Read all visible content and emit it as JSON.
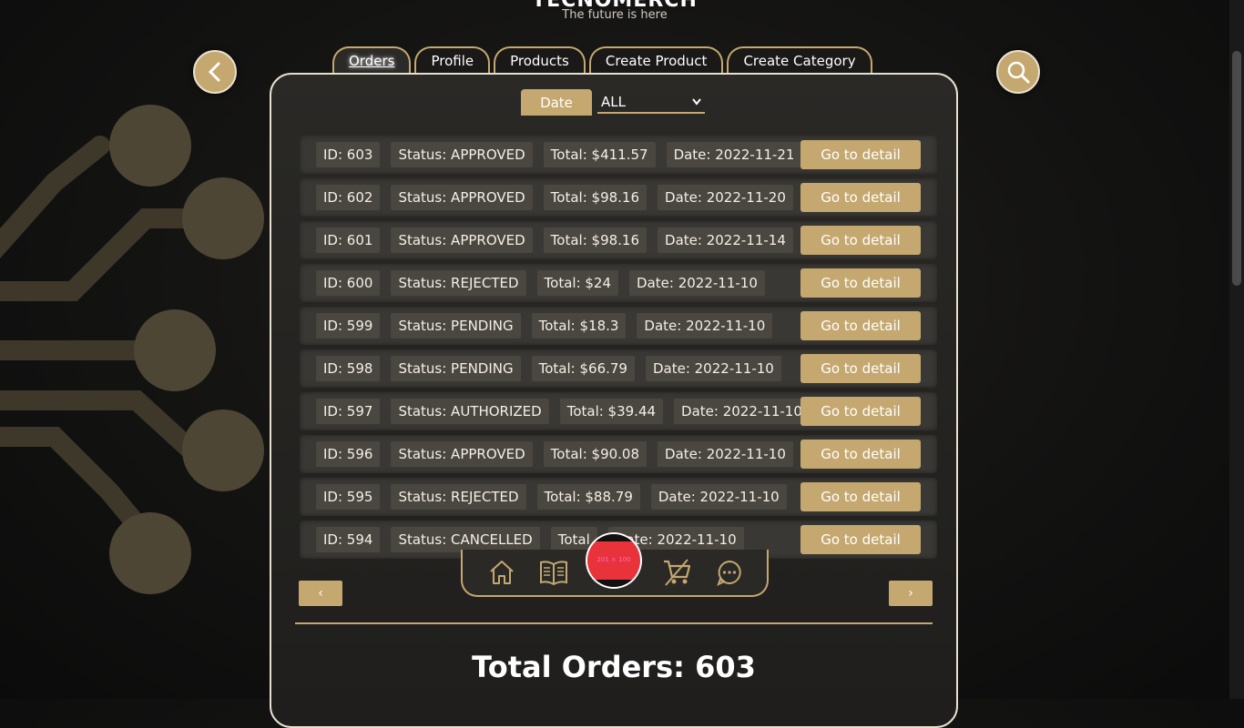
{
  "brand": {
    "name": "TECNOMERCH",
    "tagline": "The future is here"
  },
  "tabs": [
    {
      "label": "Orders",
      "active": true
    },
    {
      "label": "Profile"
    },
    {
      "label": "Products"
    },
    {
      "label": "Create Product"
    },
    {
      "label": "Create Category"
    }
  ],
  "filter": {
    "button_label": "Date",
    "select_value": "ALL"
  },
  "orders": [
    {
      "id": "ID: 603",
      "status": "Status: APPROVED",
      "total": "Total: $411.57",
      "date": "Date: 2022-11-21",
      "action": "Go to detail"
    },
    {
      "id": "ID: 602",
      "status": "Status: APPROVED",
      "total": "Total: $98.16",
      "date": "Date: 2022-11-20",
      "action": "Go to detail"
    },
    {
      "id": "ID: 601",
      "status": "Status: APPROVED",
      "total": "Total: $98.16",
      "date": "Date: 2022-11-14",
      "action": "Go to detail"
    },
    {
      "id": "ID: 600",
      "status": "Status: REJECTED",
      "total": "Total: $24",
      "date": "Date: 2022-11-10",
      "action": "Go to detail"
    },
    {
      "id": "ID: 599",
      "status": "Status: PENDING",
      "total": "Total: $18.3",
      "date": "Date: 2022-11-10",
      "action": "Go to detail"
    },
    {
      "id": "ID: 598",
      "status": "Status: PENDING",
      "total": "Total: $66.79",
      "date": "Date: 2022-11-10",
      "action": "Go to detail"
    },
    {
      "id": "ID: 597",
      "status": "Status: AUTHORIZED",
      "total": "Total: $39.44",
      "date": "Date: 2022-11-10",
      "action": "Go to detail"
    },
    {
      "id": "ID: 596",
      "status": "Status: APPROVED",
      "total": "Total: $90.08",
      "date": "Date: 2022-11-10",
      "action": "Go to detail"
    },
    {
      "id": "ID: 595",
      "status": "Status: REJECTED",
      "total": "Total: $88.79",
      "date": "Date: 2022-11-10",
      "action": "Go to detail"
    },
    {
      "id": "ID: 594",
      "status": "Status: CANCELLED",
      "total": "Total",
      "date": "Date: 2022-11-10",
      "action": "Go to detail"
    }
  ],
  "pager": {
    "prev": "‹",
    "next": "›"
  },
  "summary": {
    "total_orders": "Total Orders: 603"
  },
  "dock": {
    "center_label": "201 × 100"
  },
  "colors": {
    "accent": "#c4a870",
    "background": "#121211",
    "panel_border": "#e8e0cf"
  },
  "icons": [
    "back-arrow-icon",
    "search-icon",
    "home-icon",
    "book-icon",
    "cart-icon",
    "chat-icon",
    "chevron-down-icon"
  ]
}
